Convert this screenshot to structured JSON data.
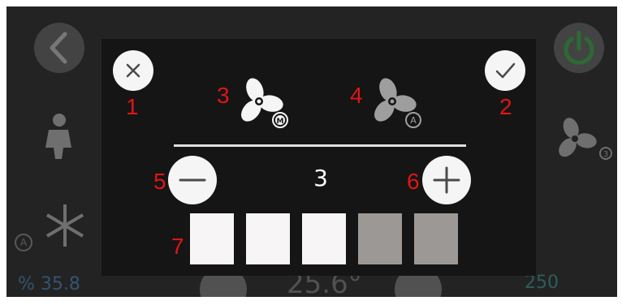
{
  "background": {
    "humidity": "% 35.8",
    "temperature": "25.6°",
    "co2": "250",
    "fan_badge": "3",
    "mode_badge": "A",
    "partial_title": "1"
  },
  "modal": {
    "fan_manual_badge": "M",
    "fan_auto_badge": "A",
    "speed_value": "3",
    "levels": [
      {
        "active": true
      },
      {
        "active": true
      },
      {
        "active": true
      },
      {
        "active": false
      },
      {
        "active": false
      }
    ]
  },
  "annotations": [
    "1",
    "2",
    "3",
    "4",
    "5",
    "6",
    "7"
  ],
  "colors": {
    "annotation": "#e01515",
    "level_on": "#f7f5f6",
    "level_off": "#9b9896",
    "modal_bg": "#151515",
    "screen_bg": "#232323"
  }
}
